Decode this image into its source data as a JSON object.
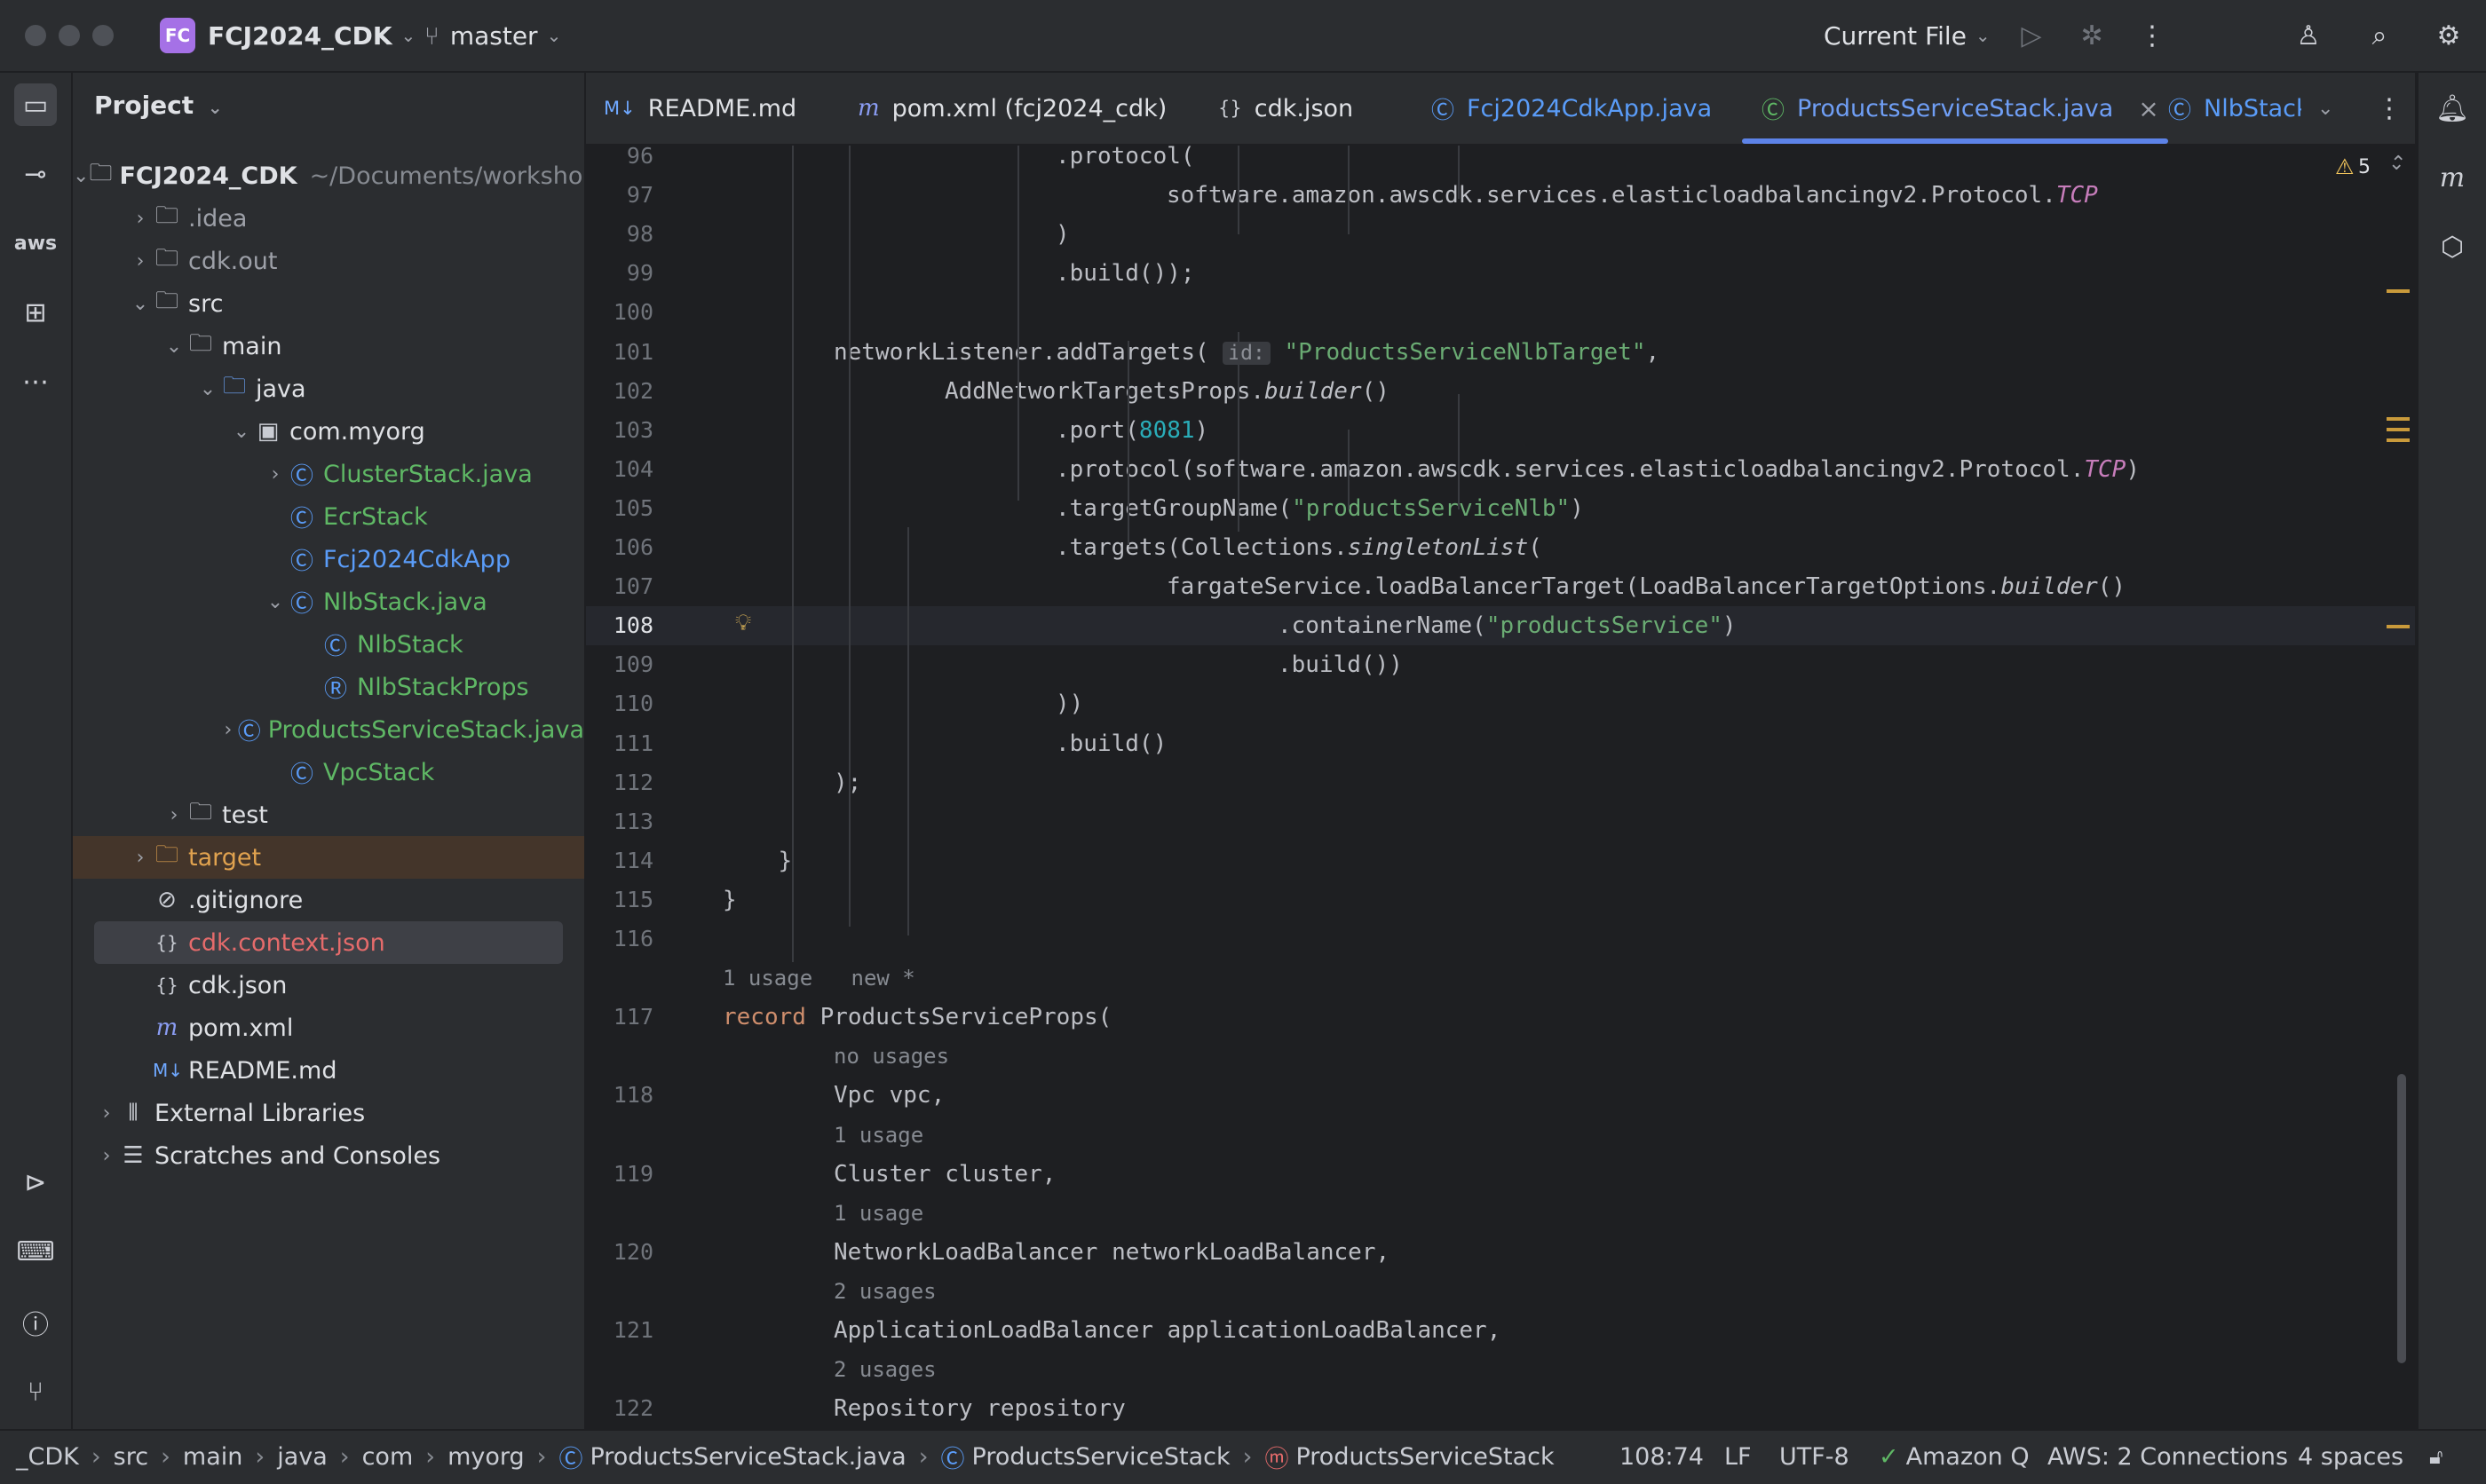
{
  "titlebar": {
    "project_badge": "FC",
    "project_name": "FCJ2024_CDK",
    "branch": "master",
    "run_config": "Current File"
  },
  "project_panel": {
    "title": "Project",
    "tree": [
      {
        "label": "FCJ2024_CDK",
        "suffix": "~/Documents/workshop",
        "indent": 0,
        "arrow": "⌄",
        "icon": "folder",
        "bold": true
      },
      {
        "label": ".idea",
        "indent": 1,
        "arrow": "›",
        "icon": "folder",
        "muted": true
      },
      {
        "label": "cdk.out",
        "indent": 1,
        "arrow": "›",
        "icon": "folder",
        "muted": true
      },
      {
        "label": "src",
        "indent": 1,
        "arrow": "⌄",
        "icon": "folder"
      },
      {
        "label": "main",
        "indent": 2,
        "arrow": "⌄",
        "icon": "folder"
      },
      {
        "label": "java",
        "indent": 3,
        "arrow": "⌄",
        "icon": "folder-blue"
      },
      {
        "label": "com.myorg",
        "indent": 4,
        "arrow": "⌄",
        "icon": "package"
      },
      {
        "label": "ClusterStack.java",
        "indent": 5,
        "arrow": "›",
        "icon": "class",
        "color": "#5fb865"
      },
      {
        "label": "EcrStack",
        "indent": 5,
        "arrow": "",
        "icon": "class",
        "color": "#5fb865"
      },
      {
        "label": "Fcj2024CdkApp",
        "indent": 5,
        "arrow": "",
        "icon": "class",
        "color": "#5a9cf8"
      },
      {
        "label": "NlbStack.java",
        "indent": 5,
        "arrow": "⌄",
        "icon": "class",
        "color": "#5fb865"
      },
      {
        "label": "NlbStack",
        "indent": 6,
        "arrow": "",
        "icon": "class",
        "color": "#5fb865"
      },
      {
        "label": "NlbStackProps",
        "indent": 6,
        "arrow": "",
        "icon": "record",
        "color": "#5fb865"
      },
      {
        "label": "ProductsServiceStack.java",
        "indent": 5,
        "arrow": "›",
        "icon": "class",
        "color": "#5fb865"
      },
      {
        "label": "VpcStack",
        "indent": 5,
        "arrow": "",
        "icon": "class",
        "color": "#5fb865"
      },
      {
        "label": "test",
        "indent": 2,
        "arrow": "›",
        "icon": "folder"
      },
      {
        "label": "target",
        "indent": 1,
        "arrow": "›",
        "icon": "folder-orange",
        "color": "#e0a24f",
        "highlight": "target"
      },
      {
        "label": ".gitignore",
        "indent": 1,
        "arrow": "",
        "icon": "ignore"
      },
      {
        "label": "cdk.context.json",
        "indent": 1,
        "arrow": "",
        "icon": "json",
        "color": "#e56b6b",
        "highlight": "file"
      },
      {
        "label": "cdk.json",
        "indent": 1,
        "arrow": "",
        "icon": "json"
      },
      {
        "label": "pom.xml",
        "indent": 1,
        "arrow": "",
        "icon": "maven"
      },
      {
        "label": "README.md",
        "indent": 1,
        "arrow": "",
        "icon": "markdown"
      },
      {
        "label": "External Libraries",
        "indent": 0,
        "arrow": "›",
        "icon": "library"
      },
      {
        "label": "Scratches and Consoles",
        "indent": 0,
        "arrow": "›",
        "icon": "scratch"
      }
    ]
  },
  "tabs": [
    {
      "label": "README.md",
      "icon": "M↓",
      "color": "#dfe1e5"
    },
    {
      "label": "pom.xml (fcj2024_cdk)",
      "icon": "m",
      "color": "#dfe1e5"
    },
    {
      "label": "cdk.json",
      "icon": "{}",
      "color": "#dfe1e5"
    },
    {
      "label": "Fcj2024CdkApp.java",
      "icon": "Ⓒ",
      "color": "#5a9cf8"
    },
    {
      "label": "ProductsServiceStack.java",
      "icon": "Ⓒ",
      "color": "#5fb865",
      "active": true
    },
    {
      "label": "NlbStack",
      "icon": "Ⓒ",
      "color": "#5a9cf8"
    }
  ],
  "editor": {
    "warnings": "5",
    "lines": [
      {
        "n": "96",
        "indent": 6,
        "html": ".protocol("
      },
      {
        "n": "97",
        "indent": 8,
        "html": "software.amazon.awscdk.services.elasticloadbalancingv2.Protocol.<span class=\"i\">TCP</span>"
      },
      {
        "n": "98",
        "indent": 6,
        "html": ")"
      },
      {
        "n": "99",
        "indent": 6,
        "html": ".build());"
      },
      {
        "n": "100",
        "indent": 0,
        "html": ""
      },
      {
        "n": "101",
        "indent": 2,
        "html": "networkListener.addTargets( <span class=\"param\">id:</span> <span class=\"s\">\"ProductsServiceNlbTarget\"</span>,"
      },
      {
        "n": "102",
        "indent": 4,
        "html": "AddNetworkTargetsProps.<span class=\"f\">builder</span>()"
      },
      {
        "n": "103",
        "indent": 6,
        "html": ".port(<span class=\"n\">8081</span>)"
      },
      {
        "n": "104",
        "indent": 6,
        "html": ".protocol(software.amazon.awscdk.services.elasticloadbalancingv2.Protocol.<span class=\"i\">TCP</span>)"
      },
      {
        "n": "105",
        "indent": 6,
        "html": ".targetGroupName(<span class=\"s\">\"productsServiceNlb\"</span>)"
      },
      {
        "n": "106",
        "indent": 6,
        "html": ".targets(Collections.<span class=\"f\">singletonList</span>("
      },
      {
        "n": "107",
        "indent": 8,
        "html": "fargateService.loadBalancerTarget(LoadBalancerTargetOptions.<span class=\"f\">builder</span>()"
      },
      {
        "n": "108",
        "indent": 10,
        "html": ".containerName(<span class=\"s\">\"productsService\"</span>)",
        "current": true
      },
      {
        "n": "109",
        "indent": 10,
        "html": ".build())"
      },
      {
        "n": "110",
        "indent": 6,
        "html": "))"
      },
      {
        "n": "111",
        "indent": 6,
        "html": ".build()"
      },
      {
        "n": "112",
        "indent": 2,
        "html": ");"
      },
      {
        "n": "113",
        "indent": 0,
        "html": ""
      },
      {
        "n": "114",
        "indent": 1,
        "html": "}"
      },
      {
        "n": "115",
        "indent": 0,
        "html": "}"
      },
      {
        "n": "116",
        "indent": 0,
        "html": ""
      },
      {
        "n": "",
        "indent": 0,
        "hint": "1 usage   new *"
      },
      {
        "n": "117",
        "indent": 0,
        "html": "<span class=\"k\">record</span> ProductsServiceProps("
      },
      {
        "n": "",
        "indent": 2,
        "hint": "no usages"
      },
      {
        "n": "118",
        "indent": 2,
        "html": "Vpc vpc,"
      },
      {
        "n": "",
        "indent": 2,
        "hint": "1 usage"
      },
      {
        "n": "119",
        "indent": 2,
        "html": "Cluster cluster,"
      },
      {
        "n": "",
        "indent": 2,
        "hint": "1 usage"
      },
      {
        "n": "120",
        "indent": 2,
        "html": "NetworkLoadBalancer networkLoadBalancer,"
      },
      {
        "n": "",
        "indent": 2,
        "hint": "2 usages"
      },
      {
        "n": "121",
        "indent": 2,
        "html": "ApplicationLoadBalancer applicationLoadBalancer,"
      },
      {
        "n": "",
        "indent": 2,
        "hint": "2 usages"
      },
      {
        "n": "122",
        "indent": 2,
        "html": "Repository repository"
      }
    ]
  },
  "statusbar": {
    "breadcrumbs": [
      "_CDK",
      "src",
      "main",
      "java",
      "com",
      "myorg",
      "ProductsServiceStack.java",
      "ProductsServiceStack",
      "ProductsServiceStack"
    ],
    "position": "108:74",
    "line_ending": "LF",
    "encoding": "UTF-8",
    "amazon_q": "Amazon Q",
    "aws": "AWS: 2 Connections",
    "indent": "4 spaces"
  }
}
